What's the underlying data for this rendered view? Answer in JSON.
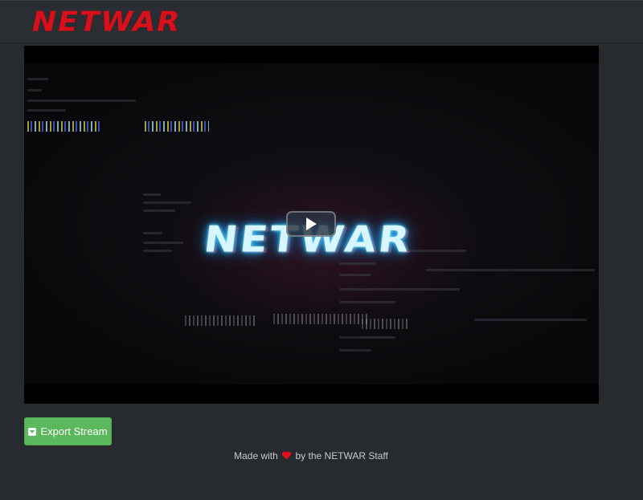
{
  "header": {
    "logo_text": "NETWAR",
    "logo_color": "#d7101b"
  },
  "player": {
    "video_logo_text": "NETWAR",
    "play_icon": "play-icon",
    "glow_color": "#2ab8ff"
  },
  "actions": {
    "export_label": "Export Stream",
    "export_icon": "caret-square-down-icon",
    "export_color": "#5cb85c"
  },
  "footer": {
    "prefix": "Made with",
    "heart_icon": "heart-icon",
    "suffix": "by the NETWAR Staff",
    "heart_color": "#e3101c"
  }
}
